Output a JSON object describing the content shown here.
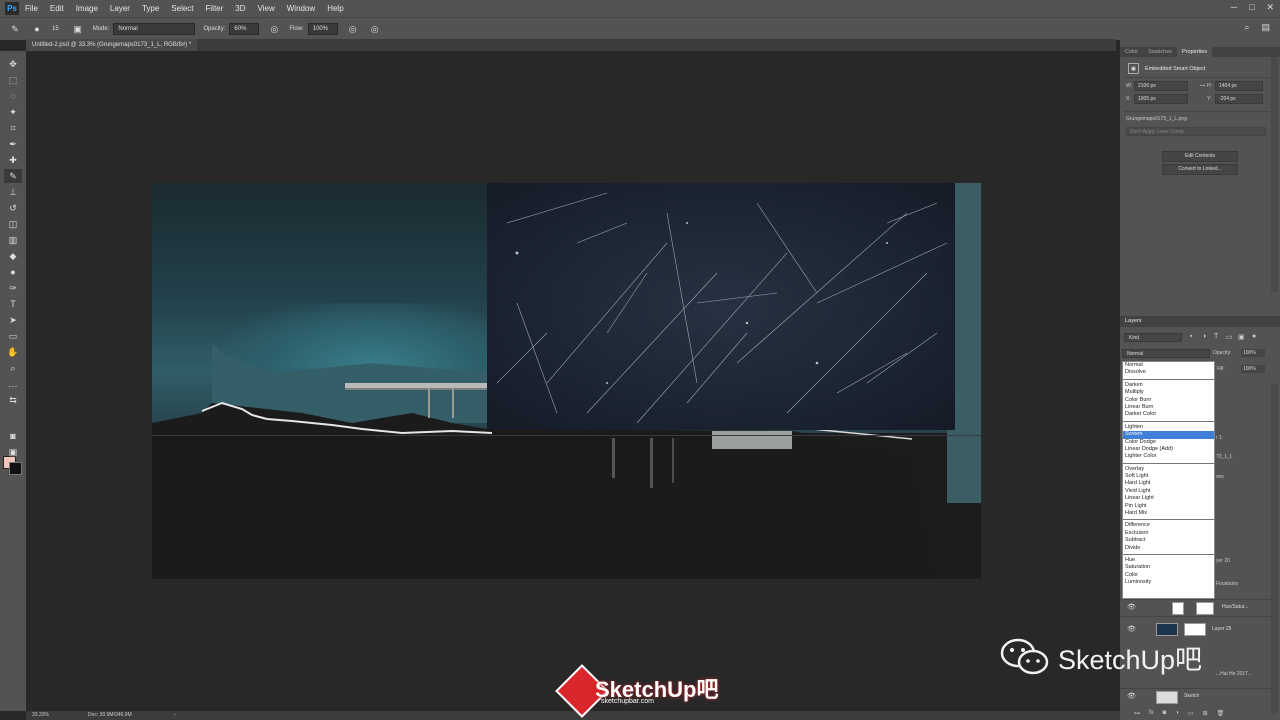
{
  "app": {
    "logo": "Ps"
  },
  "menu": [
    "File",
    "Edit",
    "Image",
    "Layer",
    "Type",
    "Select",
    "Filter",
    "3D",
    "View",
    "Window",
    "Help"
  ],
  "options": {
    "size": "15",
    "mode_label": "Mode:",
    "mode_value": "Normal",
    "opacity_label": "Opacity:",
    "opacity_value": "60%",
    "flow_label": "Flow:",
    "flow_value": "100%"
  },
  "document": {
    "tab_title": "Untitled-2.psd @ 33.3% (Grungemaps0173_1_L, RGB/8#) *"
  },
  "status": {
    "zoom": "33.33%",
    "doc": "Doc: 30.9M/346.9M"
  },
  "panel_tabs": [
    "Color",
    "Swatches",
    "Properties"
  ],
  "properties": {
    "title": "Embedded Smart Object",
    "w_label": "W:",
    "w_value": "2106 px",
    "h_label": "H:",
    "h_value": "1404 px",
    "x_label": "X:",
    "x_value": "1005 px",
    "y_label": "Y:",
    "y_value": "-204 px",
    "filename": "Grungemaps0173_1_L.png",
    "comp_placeholder": "Don't Apply Layer Comp",
    "edit_contents": "Edit Contents",
    "convert": "Convert to Linked..."
  },
  "layers": {
    "title": "Layers",
    "kind": "Kind",
    "blend_mode": "Normal",
    "opacity_label": "Opacity:",
    "opacity_value": "100%",
    "fill_label": "Fill:",
    "fill_value": "100%",
    "hue_sat": "Hue/Satur...",
    "layer25": "Layer 25",
    "sketch": "Sketch",
    "frag_1": "r 1",
    "frag_2": "73_1_L",
    "frag_3": "ves",
    "frag_4": "yer 20",
    "frag_5": "Fountains",
    "frag_6": "...Hai He 2017..."
  },
  "blend_groups": [
    [
      "Normal",
      "Dissolve"
    ],
    [
      "Darken",
      "Multiply",
      "Color Burn",
      "Linear Burn",
      "Darker Color"
    ],
    [
      "Lighten",
      "Screen",
      "Color Dodge",
      "Linear Dodge (Add)",
      "Lighter Color"
    ],
    [
      "Overlay",
      "Soft Light",
      "Hard Light",
      "Vivid Light",
      "Linear Light",
      "Pin Light",
      "Hard Mix"
    ],
    [
      "Difference",
      "Exclusion",
      "Subtract",
      "Divide"
    ],
    [
      "Hue",
      "Saturation",
      "Color",
      "Luminosity"
    ]
  ],
  "blend_selected": "Screen",
  "watermarks": {
    "bottom_text": "SketchUp吧",
    "bottom_url": "sketchupbar.com",
    "right_text": "SketchUp吧"
  }
}
